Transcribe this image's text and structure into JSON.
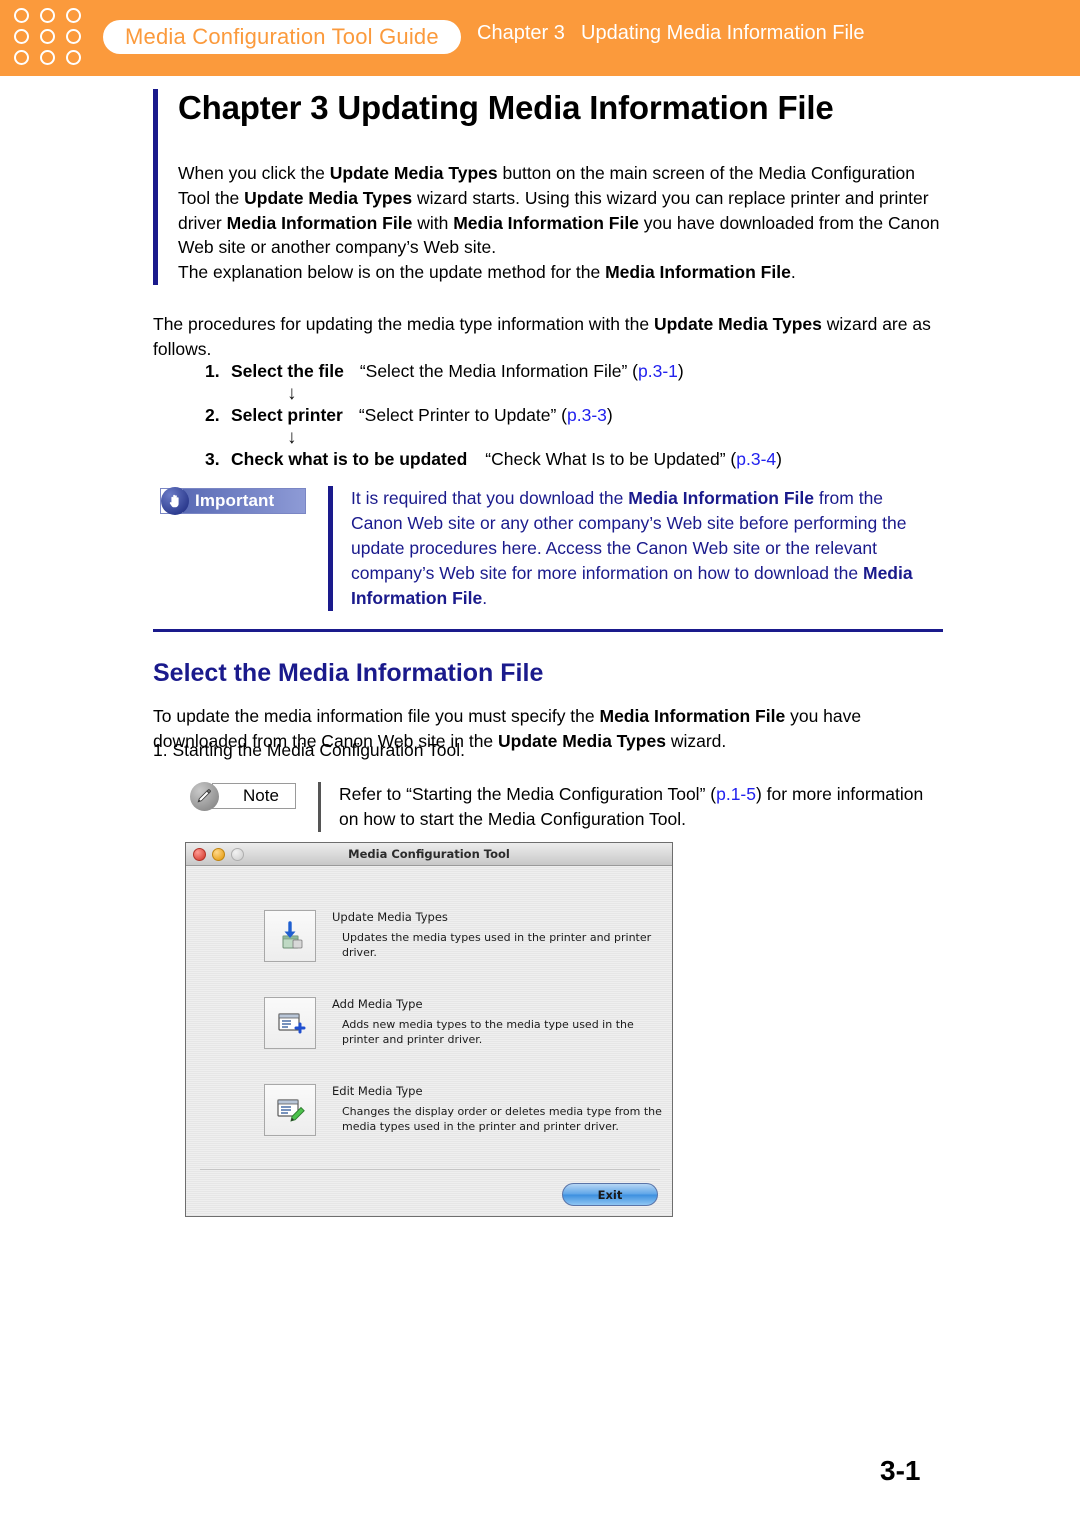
{
  "header": {
    "guide_pill": "Media Configuration Tool Guide",
    "chapter_label": "Chapter 3",
    "chapter_title": "Updating Media Information File",
    "band_color": "#FB9A3C",
    "pill_text_color": "#FB9A3C",
    "dot_count": 9
  },
  "chapter": {
    "title": "Chapter 3  Updating Media Information File",
    "intro_html": "When you click the <b>Update Media Types</b> button on the main screen of the Media Configuration Tool the <b>Update Media Types</b> wizard starts. Using this wizard you can replace printer and printer driver <b>Media Information File</b> with <b>Media Information File</b> you have downloaded from the Canon Web site or another company’s Web site.<br>The explanation below is on the update method for the <b>Media Information File</b>."
  },
  "procedure": {
    "intro_html": "The procedures for updating the media type information with the <b>Update Media Types</b> wizard are as follows.",
    "steps": [
      {
        "number": "1.",
        "label": "Select the file",
        "reference": "“Select the Media Information File” (",
        "page_ref": "p.3-1",
        "reference_end": ")"
      },
      {
        "number": "2.",
        "label": "Select printer",
        "reference": "“Select Printer to Update” (",
        "page_ref": "p.3-3",
        "reference_end": ")"
      },
      {
        "number": "3.",
        "label": "Check what is to be updated",
        "reference": "“Check What Is to be Updated” (",
        "page_ref": "p.3-4",
        "reference_end": ")"
      }
    ],
    "arrow_glyph": "↓"
  },
  "important": {
    "badge_label": "Important",
    "badge_icon": "hand-icon",
    "body_html": "It is required that you download the <b>Media Information File</b> from the Canon Web site or any other company’s Web site before performing the update procedures here. Access the Canon Web site or the relevant company’s Web site for more information on how to download the <b>Media Information File</b>.",
    "text_color": "#1A1A8C"
  },
  "section": {
    "heading": "Select the Media Information File",
    "heading_color": "#1A1A8C",
    "body_html": "To update the media information file you must specify the <b>Media Information File</b> you have downloaded from the Canon Web site in the <b>Update Media Types</b> wizard.",
    "numbered_item": "1.  Starting the Media Configuration Tool."
  },
  "note": {
    "badge_label": "Note",
    "badge_icon": "pencil-icon",
    "body_html": "Refer to “Starting the Media Configuration Tool” (<span class=\"pref\">p.1-5</span>) for more information on how to start the Media Configuration Tool."
  },
  "app_screenshot": {
    "window_title": "Media Configuration Tool",
    "traffic_lights": [
      "close-light",
      "minimize-light",
      "zoom-light"
    ],
    "features": [
      {
        "icon": "update-media-types-icon",
        "title": "Update Media Types",
        "description": "Updates the media types used in the printer and printer driver."
      },
      {
        "icon": "add-media-type-icon",
        "title": "Add Media Type",
        "description": "Adds new media types to the media type used in the printer and printer driver."
      },
      {
        "icon": "edit-media-type-icon",
        "title": "Edit Media Type",
        "description": "Changes the display order or deletes media type from the media types used in the printer and printer driver."
      }
    ],
    "exit_button": "Exit"
  },
  "footer": {
    "page_number": "3-1"
  }
}
